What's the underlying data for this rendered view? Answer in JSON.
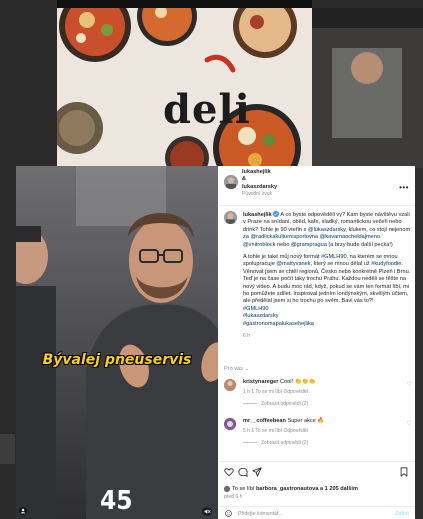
{
  "background": {
    "feed_card_word": "deli"
  },
  "video": {
    "overlay_text": "Bývalej pneuservis",
    "overlay_number": "45",
    "icons": {
      "user_tag": "user-tag-icon",
      "mute": "mute-icon"
    }
  },
  "header": {
    "author": "lukashejlik",
    "author_line2": "&",
    "coauthor": "lukaszdarsky",
    "audio": "Původní zvuk",
    "more_icon": "more-icon"
  },
  "caption": {
    "username": "lukashejlik",
    "verified_icon": "verified-icon",
    "p1": "A co byste odpověděli vy? Kam byste návštěvu vzali v Praze na snídani, oběd, kafe, sladký, romantickou večeři nebo drink? Tohle je 90 vteřin s",
    "p1_mention": "@lukaszdarsky",
    "p1b": ", klukem, co stojí nejenom za",
    "p1_mention2": "@radlickakulturnisportovna",
    "p1c": "",
    "p1_mention3": "@kavarnaocheldajmeno @vnitroblock",
    "p1d": "nebo",
    "p1_mention4": "@grampragua",
    "p1e": "(a brzy bude další pecka!)",
    "p2": "A tohle je také můj nový formát",
    "p2_tag": "#GMLH90",
    "p2b": ", na kterém se mnou spolupracuje",
    "p2_mention": "@mattyvanek",
    "p2c": ", který se mnou dělal už",
    "p2_mention2": "#kudyfoodie",
    "p2d": ". Věnovat jsem se chtěl regionů, Česko nebo konkrétně Plzeň i Brnu. Teď je na čase počít taky trochu Prahu. Každou neděli se těšte na nový video. A budu moc rád, když, pokud se vám ten formát líbí, mi ho pomůžete sdílet. Inspiroval jedním londýnským, skvělým účtem, ale předělal jsem si ho trochu po svém. Bavi vás to?!",
    "tag1": "#GMLH90",
    "tag2": "#lukaszdarsky",
    "tag3": "#gastronomapalukasehejlika",
    "time": "6 h"
  },
  "comments": {
    "preview_label": "Pro vás",
    "items": [
      {
        "username": "kristynareger",
        "text": "Cool! 👏👏👏",
        "meta": "1 h    1 To se mi líbí    Odpovědět",
        "replies": "Zobrazit odpovědi (2)"
      },
      {
        "username": "mr__coffeebean",
        "text": "Super akce 🔥",
        "meta": "5 h    1 To se mi líbí    Odpovědět",
        "replies": "Zobrazit odpovědi (2)"
      }
    ]
  },
  "actions": {
    "likes_prefix": "To se líbí",
    "likes_user": "barbora_gastronautova",
    "likes_suffix": "a 1 205 dalším",
    "posted": "před 6 h",
    "add_comment_placeholder": "Přidejte komentář...",
    "post_label": "Sdílet"
  },
  "colors": {
    "overlay_text": "#ffd400",
    "link_blue": "#00376b",
    "muted": "#8e8e8e",
    "verified": "#3897f0",
    "post_disabled": "#b2dffc"
  }
}
